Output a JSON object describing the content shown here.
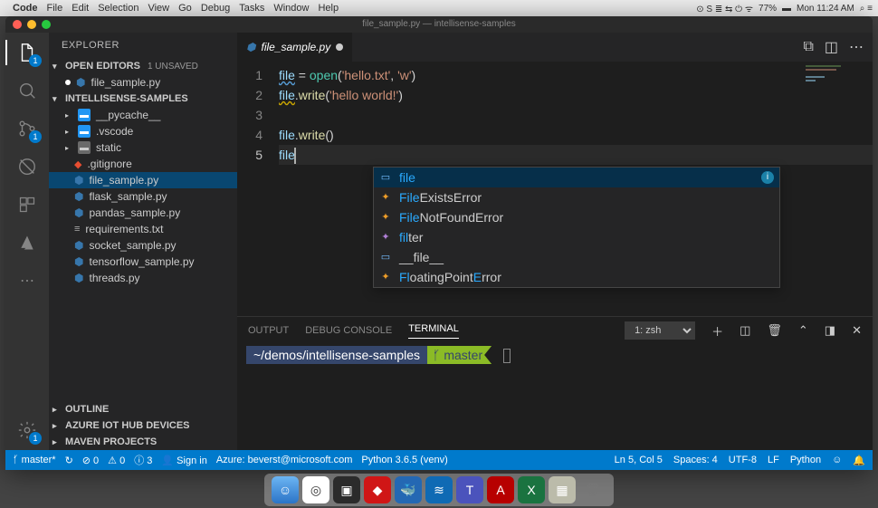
{
  "menubar": {
    "app": "Code",
    "items": [
      "File",
      "Edit",
      "Selection",
      "View",
      "Go",
      "Debug",
      "Tasks",
      "Window",
      "Help"
    ],
    "battery": "77%",
    "clock": "Mon 11:24 AM"
  },
  "window_title": "file_sample.py — intellisense-samples",
  "activity": {
    "explorer_badge": "1",
    "scm_badge": "1",
    "settings_badge": "1"
  },
  "sidebar": {
    "title": "EXPLORER",
    "open_editors": {
      "label": "OPEN EDITORS",
      "badge": "1 UNSAVED"
    },
    "open_file": "file_sample.py",
    "workspace": "INTELLISENSE-SAMPLES",
    "folders": [
      "__pycache__",
      ".vscode",
      "static"
    ],
    "files": [
      ".gitignore",
      "file_sample.py",
      "flask_sample.py",
      "pandas_sample.py",
      "requirements.txt",
      "socket_sample.py",
      "tensorflow_sample.py",
      "threads.py"
    ],
    "outline": "OUTLINE",
    "iot": "AZURE IOT HUB DEVICES",
    "maven": "MAVEN PROJECTS"
  },
  "tab": {
    "name": "file_sample.py"
  },
  "code": {
    "l1": {
      "a": "file",
      "b": " = ",
      "c": "open",
      "d": "(",
      "e": "'hello.txt'",
      "f": ", ",
      "g": "'w'",
      "h": ")"
    },
    "l2": {
      "a": "file",
      "b": ".",
      "c": "write",
      "d": "(",
      "e": "'hello world!'",
      "f": ")"
    },
    "l4": {
      "a": "file",
      "b": ".",
      "c": "write",
      "d": "()"
    },
    "l5": {
      "a": "file"
    }
  },
  "suggest": [
    {
      "icon": "var",
      "pre": "file",
      "post": ""
    },
    {
      "icon": "class",
      "pre": "File",
      "post": "ExistsError"
    },
    {
      "icon": "class",
      "pre": "File",
      "post": "NotFoundError"
    },
    {
      "icon": "fn",
      "pre": "fil",
      "post": "ter"
    },
    {
      "icon": "const",
      "pre": "",
      "post": "__file__"
    },
    {
      "icon": "class",
      "pre": "Fl",
      "post": "oatingPoint",
      "pre2": "E",
      "post2": "rror"
    }
  ],
  "panel": {
    "tabs": [
      "OUTPUT",
      "DEBUG CONSOLE",
      "TERMINAL"
    ],
    "shell": "1: zsh",
    "prompt_path": "~/demos/intellisense-samples",
    "prompt_branch": "master"
  },
  "status": {
    "branch": "master*",
    "sync": "↻",
    "errors": "⊘ 0",
    "warnings": "⚠ 0",
    "info": "ⓘ 3",
    "signin": "Sign in",
    "azure": "Azure: beverst@microsoft.com",
    "python": "Python 3.6.5 (venv)",
    "pos": "Ln 5, Col 5",
    "spaces": "Spaces: 4",
    "enc": "UTF-8",
    "eol": "LF",
    "lang": "Python",
    "smile": "☺"
  }
}
